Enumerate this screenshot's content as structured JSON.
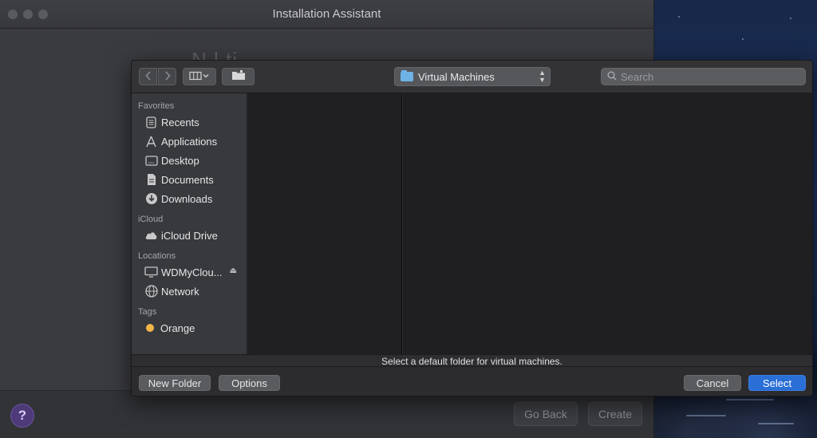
{
  "window": {
    "title": "Installation Assistant",
    "background_heading": "N                       l      ti",
    "help_label": "?",
    "go_back_label": "Go Back",
    "create_label": "Create"
  },
  "dialog": {
    "toolbar": {
      "back_icon": "chevron-left-icon",
      "forward_icon": "chevron-right-icon",
      "view_icon": "columns-view-icon",
      "new_folder_icon": "folder-icon",
      "path_label": "Virtual Machines",
      "search_placeholder": "Search",
      "search_value": ""
    },
    "sidebar": {
      "favorites_header": "Favorites",
      "favorites": [
        {
          "label": "Recents",
          "icon": "clock-icon"
        },
        {
          "label": "Applications",
          "icon": "applications-icon"
        },
        {
          "label": "Desktop",
          "icon": "desktop-icon"
        },
        {
          "label": "Documents",
          "icon": "document-icon"
        },
        {
          "label": "Downloads",
          "icon": "download-icon"
        }
      ],
      "icloud_header": "iCloud",
      "icloud": [
        {
          "label": "iCloud Drive",
          "icon": "cloud-icon"
        }
      ],
      "locations_header": "Locations",
      "locations": [
        {
          "label": "WDMyClou...",
          "icon": "display-icon",
          "eject_icon": "eject-icon"
        },
        {
          "label": "Network",
          "icon": "globe-icon"
        }
      ],
      "tags_header": "Tags",
      "tags": [
        {
          "label": "Orange",
          "color": "#f2b74a"
        }
      ]
    },
    "message": "Select a default folder for virtual machines.",
    "footer": {
      "new_folder_label": "New Folder",
      "options_label": "Options",
      "cancel_label": "Cancel",
      "select_label": "Select"
    }
  },
  "colors": {
    "accent": "#2a6fd6",
    "help_button": "#4e3a78",
    "tag_orange": "#f2b74a"
  }
}
